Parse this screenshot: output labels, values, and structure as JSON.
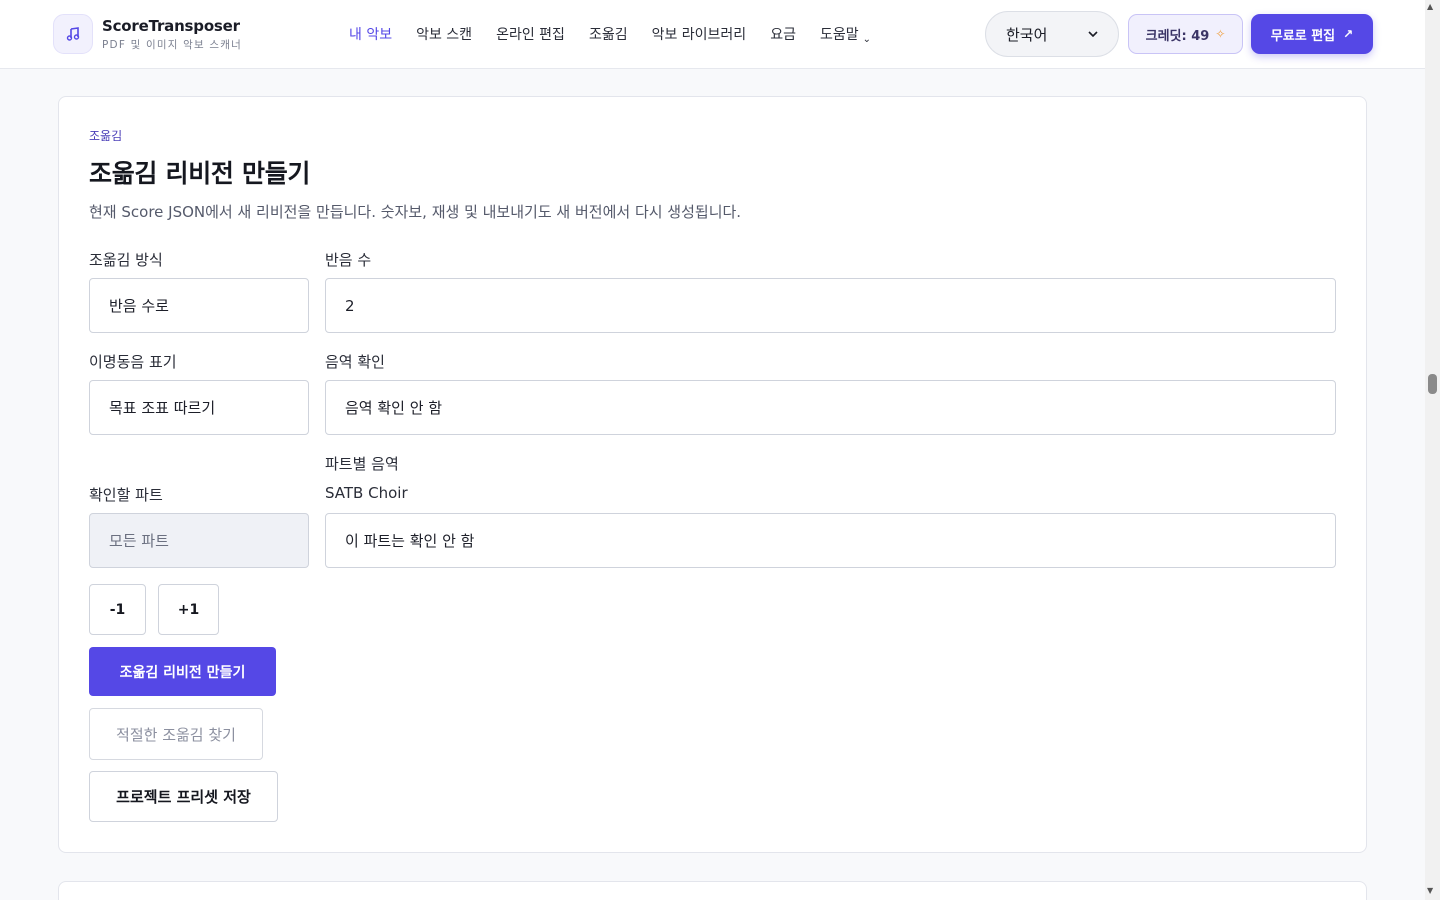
{
  "header": {
    "brand_name": "ScoreTransposer",
    "brand_sub": "PDF 및 이미지 악보 스캐너",
    "logo_icon": "music-note-icon",
    "nav": [
      {
        "label": "내 악보",
        "active": true
      },
      {
        "label": "악보 스캔"
      },
      {
        "label": "온라인 편집"
      },
      {
        "label": "조옮김"
      },
      {
        "label": "악보 라이브러리"
      },
      {
        "label": "요금"
      },
      {
        "label": "도움말"
      }
    ],
    "nav_chevron": "⌄",
    "language": "한국어",
    "credits": "크레딧: 49",
    "cta": "무료로 편집",
    "accent_color": "#5548e6"
  },
  "card": {
    "eyebrow": "조옮김",
    "title": "조옮김 리비전 만들기",
    "description": "현재 Score JSON에서 새 리비전을 만듭니다. 숫자보, 재생 및 내보내기도 새 버전에서 다시 생성됩니다.",
    "method_label": "조옮김 방식",
    "method_value": "반음 수로",
    "semitone_label": "반음 수",
    "semitone_value": "2",
    "enharmonic_label": "이명동음 표기",
    "enharmonic_value": "목표 조표 따르기",
    "range_label": "음역 확인",
    "range_value": "음역 확인 안 함",
    "part_range_label": "파트별 음역",
    "part_name": "SATB Choir",
    "check_part_label": "확인할 파트",
    "check_part_value": "모든 파트",
    "part_range_value": "이 파트는 확인 안 함",
    "minus_btn": "-1",
    "plus_btn": "+1",
    "create_btn": "조옮김 리비전 만들기",
    "find_btn": "적절한 조옮김 찾기",
    "save_preset_btn": "프로젝트 프리셋 저장"
  }
}
